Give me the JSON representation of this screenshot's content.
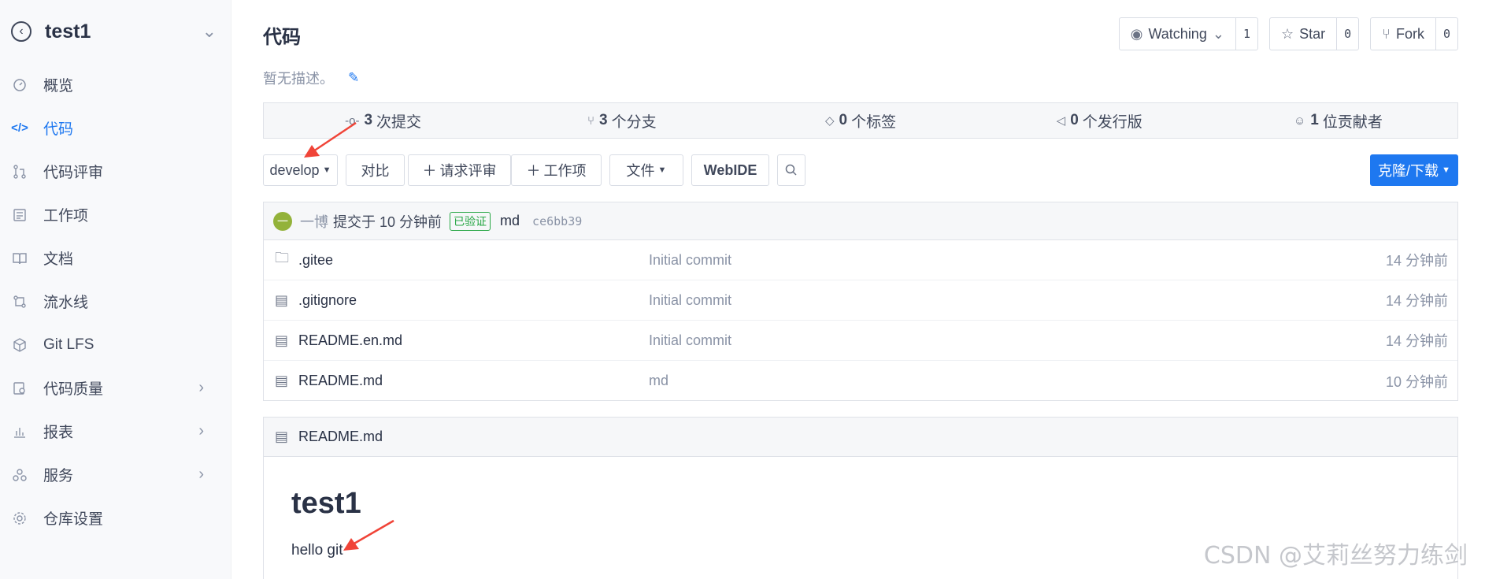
{
  "sidebar": {
    "repo_name": "test1",
    "items": [
      {
        "label": "概览",
        "icon": "gauge-icon"
      },
      {
        "label": "代码",
        "icon": "code-icon",
        "active": true
      },
      {
        "label": "代码评审",
        "icon": "pull-request-icon"
      },
      {
        "label": "工作项",
        "icon": "task-icon"
      },
      {
        "label": "文档",
        "icon": "book-icon"
      },
      {
        "label": "流水线",
        "icon": "pipeline-icon"
      },
      {
        "label": "Git LFS",
        "icon": "cube-icon"
      },
      {
        "label": "代码质量",
        "icon": "quality-icon",
        "expandable": true
      },
      {
        "label": "报表",
        "icon": "chart-icon",
        "expandable": true
      },
      {
        "label": "服务",
        "icon": "services-icon",
        "expandable": true
      },
      {
        "label": "仓库设置",
        "icon": "gear-icon"
      }
    ]
  },
  "header": {
    "title": "代码",
    "description": "暂无描述。",
    "watching_label": "Watching",
    "watching_count": "1",
    "star_label": "Star",
    "star_count": "0",
    "fork_label": "Fork",
    "fork_count": "0"
  },
  "stats": {
    "commits_count": "3",
    "commits_label": "次提交",
    "branches_count": "3",
    "branches_label": "个分支",
    "tags_count": "0",
    "tags_label": "个标签",
    "releases_count": "0",
    "releases_label": "个发行版",
    "contributors_count": "1",
    "contributors_label": "位贡献者"
  },
  "toolbar": {
    "branch": "develop",
    "compare": "对比",
    "request_review": "请求评审",
    "work_item": "工作项",
    "file": "文件",
    "webide": "WebIDE",
    "clone": "克隆/下载"
  },
  "last_commit": {
    "avatar_text": "一",
    "author": "一博",
    "time": "提交于 10 分钟前",
    "verified": "已验证",
    "message": "md",
    "sha": "ce6bb39"
  },
  "files": [
    {
      "name": ".gitee",
      "type": "folder",
      "message": "Initial commit",
      "time": "14 分钟前"
    },
    {
      "name": ".gitignore",
      "type": "file",
      "message": "Initial commit",
      "time": "14 分钟前"
    },
    {
      "name": "README.en.md",
      "type": "file",
      "message": "Initial commit",
      "time": "14 分钟前"
    },
    {
      "name": "README.md",
      "type": "file",
      "message": "md",
      "time": "10 分钟前"
    }
  ],
  "readme": {
    "filename": "README.md",
    "heading": "test1",
    "content": "hello git"
  },
  "watermark": "CSDN @艾莉丝努力练剑",
  "colors": {
    "accent": "#1e78f0",
    "annotation_arrow": "#f04438",
    "verified": "#28a745"
  }
}
